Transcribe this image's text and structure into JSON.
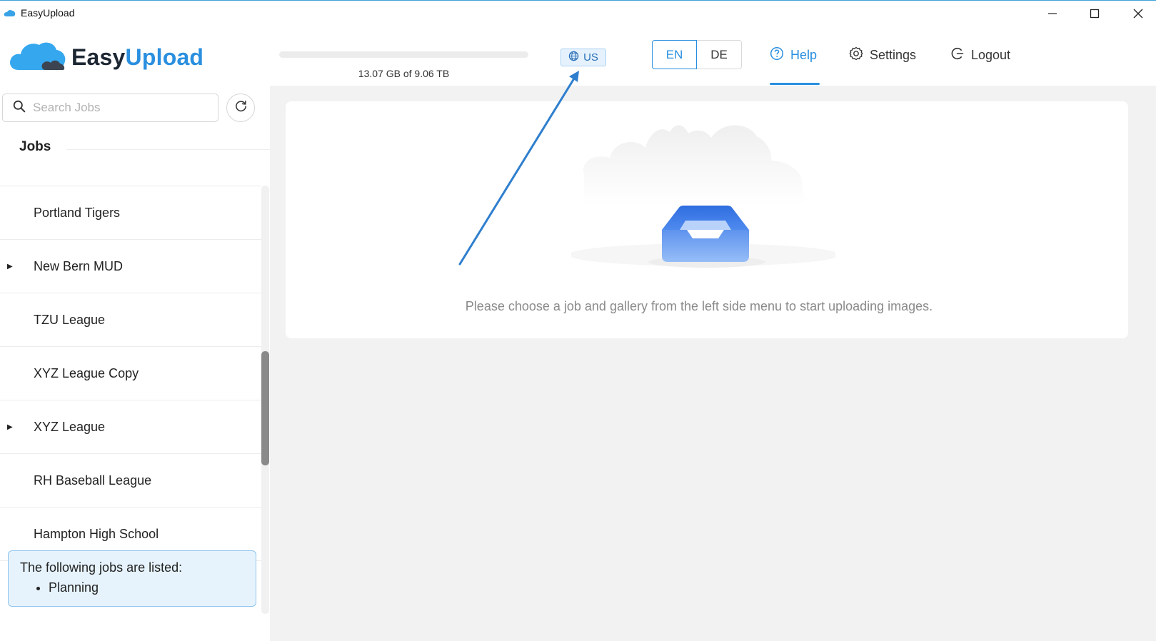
{
  "window": {
    "title": "EasyUpload",
    "controls": [
      "minimize-icon",
      "maximize-icon",
      "close-icon"
    ]
  },
  "header": {
    "logo": {
      "part1": "Easy",
      "part2": "Upload",
      "icon": "cloud-icon"
    },
    "usage": {
      "text": "13.07 GB of 9.06 TB",
      "fraction": 0.0
    },
    "region": {
      "label": "US",
      "icon": "globe-icon"
    },
    "languages": [
      {
        "label": "EN",
        "active": true
      },
      {
        "label": "DE",
        "active": false
      }
    ],
    "nav": {
      "help": {
        "label": "Help",
        "icon": "help-circle-icon",
        "active": true
      },
      "settings": {
        "label": "Settings",
        "icon": "gear-icon"
      },
      "logout": {
        "label": "Logout",
        "icon": "logout-icon"
      }
    }
  },
  "sidebar": {
    "search": {
      "placeholder": "Search Jobs",
      "value": ""
    },
    "refresh_icon": "refresh-icon",
    "jobs_title": "Jobs",
    "jobs": [
      {
        "label": "Portland Tigers",
        "expandable": false
      },
      {
        "label": "New Bern MUD",
        "expandable": true
      },
      {
        "label": "TZU League",
        "expandable": false
      },
      {
        "label": "XYZ League Copy",
        "expandable": false
      },
      {
        "label": "XYZ League",
        "expandable": true
      },
      {
        "label": "RH Baseball League",
        "expandable": false
      },
      {
        "label": "Hampton High School",
        "expandable": false
      }
    ],
    "info": {
      "text": "The following jobs are listed:",
      "items": [
        "Planning"
      ]
    }
  },
  "main": {
    "empty_message": "Please choose a job and gallery from the left side menu to start uploading images.",
    "empty_icon": "empty-inbox-icon"
  },
  "colors": {
    "accent": "#2a8fdf",
    "info_bg": "#e6f3fd",
    "main_bg": "#f2f2f2"
  }
}
